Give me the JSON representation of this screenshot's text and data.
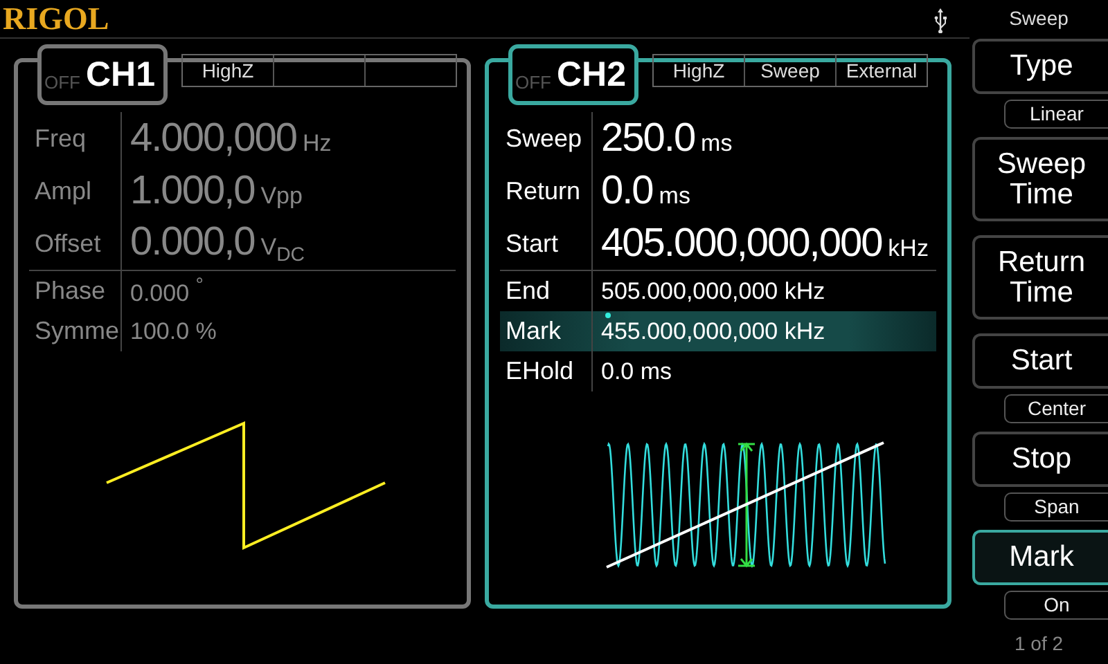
{
  "logo": "RIGOL",
  "channels": [
    {
      "name": "CH1",
      "output": "OFF",
      "active": false,
      "tags": [
        "HighZ"
      ],
      "waveform": {
        "kind": "ramp"
      },
      "params": [
        {
          "label": "Freq",
          "value": "4.000,000",
          "unit": "Hz",
          "kind": "large",
          "selected": false
        },
        {
          "label": "Ampl",
          "value": "1.000,0",
          "unit": "Vpp",
          "kind": "large",
          "selected": false
        },
        {
          "label": "Offset",
          "value": "0.000,0",
          "unit": "V$_{DC}$",
          "kind": "large",
          "selected": false
        },
        {
          "label": "Phase",
          "value": "0.000",
          "unit": "$^{°}$",
          "kind": "small",
          "selected": false
        },
        {
          "label": "Symme",
          "value": "100.0 %",
          "kind": "small",
          "selected": false
        }
      ]
    },
    {
      "name": "CH2",
      "output": "OFF",
      "active": true,
      "tags": [
        "HighZ",
        "Sweep",
        "External"
      ],
      "waveform": {
        "kind": "sweep"
      },
      "params": [
        {
          "label": "Sweep",
          "value": "250.0",
          "unit": "ms",
          "kind": "large",
          "selected": false
        },
        {
          "label": "Return",
          "value": "0.0",
          "unit": "ms",
          "kind": "large",
          "selected": false
        },
        {
          "label": "Start",
          "value": "405.000,000,000",
          "unit": "kHz",
          "kind": "large",
          "selected": false
        },
        {
          "label": "End",
          "value": "505.000,000,000 kHz",
          "kind": "small",
          "selected": false
        },
        {
          "label": "Mark",
          "value": "455.000,000,000 kHz",
          "kind": "small",
          "selected": true
        },
        {
          "label": "EHold",
          "value": "0.0 ms",
          "kind": "small",
          "selected": false
        }
      ]
    }
  ],
  "menu": {
    "title": "Sweep",
    "keys": [
      {
        "label": "Type",
        "option": "Linear",
        "selected": false
      },
      {
        "label": "Sweep Time",
        "selected": false
      },
      {
        "label": "Return Time",
        "selected": false
      },
      {
        "label": "Start",
        "option": "Center",
        "selected": false
      },
      {
        "label": "Stop",
        "option": "Span",
        "selected": false
      },
      {
        "label": "Mark",
        "option": "On",
        "selected": true
      }
    ],
    "page": "1 of 2"
  }
}
